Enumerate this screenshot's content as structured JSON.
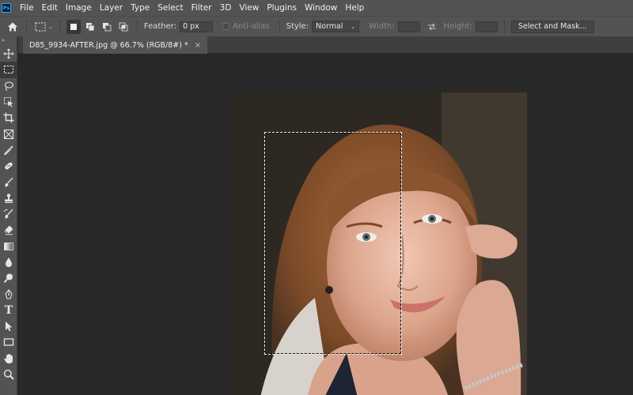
{
  "app": {
    "logo_text": "Ps"
  },
  "menu": [
    "File",
    "Edit",
    "Image",
    "Layer",
    "Type",
    "Select",
    "Filter",
    "3D",
    "View",
    "Plugins",
    "Window",
    "Help"
  ],
  "options": {
    "feather_label": "Feather:",
    "feather_value": "0 px",
    "antialias_label": "Anti-alias",
    "style_label": "Style:",
    "style_value": "Normal",
    "width_label": "Width:",
    "height_label": "Height:",
    "select_mask_label": "Select and Mask..."
  },
  "document": {
    "tab_title": "D85_9934-AFTER.jpg @ 66.7% (RGB/8#) *",
    "close_glyph": "×"
  },
  "toolbar": {
    "collapse_glyph": "»",
    "tools": [
      "move-tool",
      "marquee-tool",
      "lasso-tool",
      "object-selection-tool",
      "crop-tool",
      "frame-tool",
      "eyedropper-tool",
      "healing-brush-tool",
      "brush-tool",
      "clone-stamp-tool",
      "history-brush-tool",
      "eraser-tool",
      "gradient-tool",
      "blur-tool",
      "dodge-tool",
      "pen-tool",
      "type-tool",
      "path-selection-tool",
      "rectangle-tool",
      "hand-tool",
      "zoom-tool"
    ],
    "type_glyph": "T"
  },
  "colors": {
    "ui_panel": "#535353",
    "canvas": "#282828",
    "accent": "#31a8ff"
  }
}
